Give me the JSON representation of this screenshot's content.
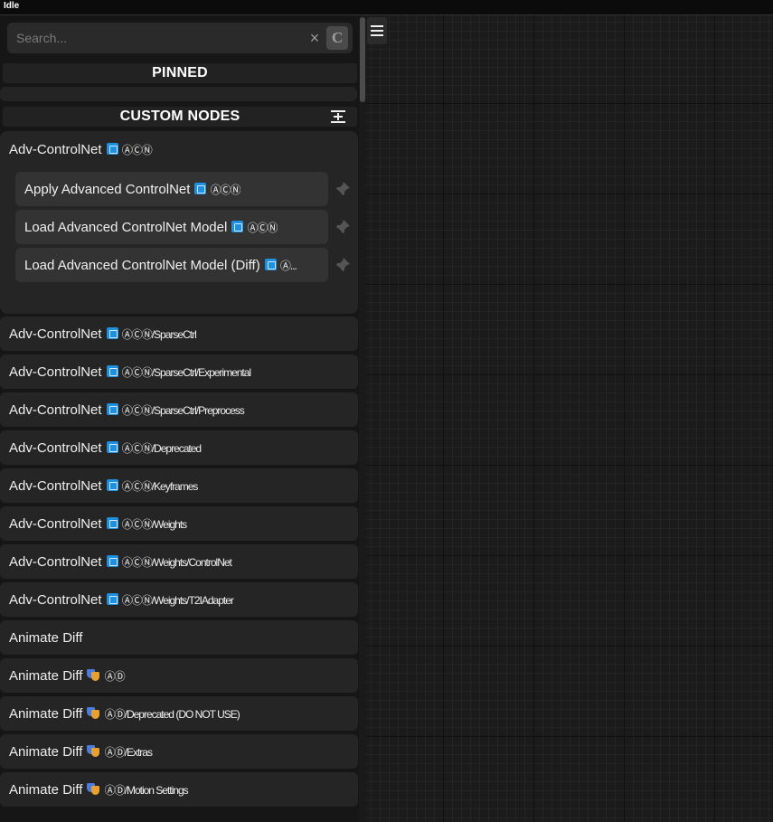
{
  "status": "Idle",
  "search": {
    "placeholder": "Search...",
    "clear_glyph": "×",
    "case_toggle": "C"
  },
  "sections": {
    "pinned": "PINNED",
    "custom": "CUSTOM NODES"
  },
  "expanded_group": {
    "title": "Adv-ControlNet",
    "suffix": "ⒶⒸⓃ",
    "nodes": [
      {
        "label": "Apply Advanced ControlNet",
        "suffix": "ⒶⒸⓃ"
      },
      {
        "label": "Load Advanced ControlNet Model",
        "suffix": "ⒶⒸⓃ"
      },
      {
        "label": "Load Advanced ControlNet Model (Diff)",
        "suffix": "Ⓐ..."
      }
    ]
  },
  "groups": [
    {
      "base": "Adv-ControlNet",
      "icon": "control-emoji-icon",
      "suffix": "ⒶⒸⓃ/SparseCtrl"
    },
    {
      "base": "Adv-ControlNet",
      "icon": "control-emoji-icon",
      "suffix": "ⒶⒸⓃ/SparseCtrl/Experimental"
    },
    {
      "base": "Adv-ControlNet",
      "icon": "control-emoji-icon",
      "suffix": "ⒶⒸⓃ/SparseCtrl/Preprocess"
    },
    {
      "base": "Adv-ControlNet",
      "icon": "control-emoji-icon",
      "suffix": "ⒶⒸⓃ/Deprecated"
    },
    {
      "base": "Adv-ControlNet",
      "icon": "control-emoji-icon",
      "suffix": "ⒶⒸⓃ/Keyframes"
    },
    {
      "base": "Adv-ControlNet",
      "icon": "control-emoji-icon",
      "suffix": "ⒶⒸⓃ/Weights"
    },
    {
      "base": "Adv-ControlNet",
      "icon": "control-emoji-icon",
      "suffix": "ⒶⒸⓃ/Weights/ControlNet"
    },
    {
      "base": "Adv-ControlNet",
      "icon": "control-emoji-icon",
      "suffix": "ⒶⒸⓃ/Weights/T2IAdapter"
    },
    {
      "base": "Animate Diff",
      "icon": "",
      "suffix": ""
    },
    {
      "base": "Animate Diff",
      "icon": "masks-emoji-icon",
      "suffix": "ⒶⒹ"
    },
    {
      "base": "Animate Diff",
      "icon": "masks-emoji-icon",
      "suffix": "ⒶⒹ/Deprecated (DO NOT USE)"
    },
    {
      "base": "Animate Diff",
      "icon": "masks-emoji-icon",
      "suffix": "ⒶⒹ/Extras"
    },
    {
      "base": "Animate Diff",
      "icon": "masks-emoji-icon",
      "suffix": "ⒶⒹ/Motion Settings"
    }
  ]
}
